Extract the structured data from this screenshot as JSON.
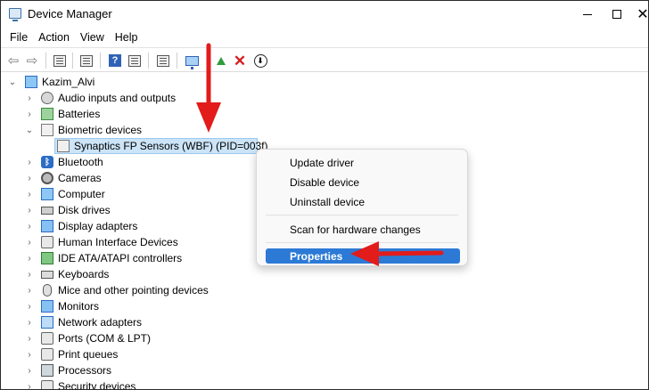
{
  "window": {
    "title": "Device Manager"
  },
  "menu": [
    "File",
    "Action",
    "View",
    "Help"
  ],
  "tree": {
    "root": "Kazim_Alvi",
    "categories": [
      {
        "label": "Audio inputs and outputs",
        "icon": "speaker-icon",
        "expanded": false
      },
      {
        "label": "Batteries",
        "icon": "battery-icon",
        "expanded": false
      },
      {
        "label": "Biometric devices",
        "icon": "fingerprint-icon",
        "expanded": true
      },
      {
        "label": "Bluetooth",
        "icon": "bluetooth-icon",
        "expanded": false
      },
      {
        "label": "Cameras",
        "icon": "camera-icon",
        "expanded": false
      },
      {
        "label": "Computer",
        "icon": "computer-icon",
        "expanded": false
      },
      {
        "label": "Disk drives",
        "icon": "disk-icon",
        "expanded": false
      },
      {
        "label": "Display adapters",
        "icon": "display-adapter-icon",
        "expanded": false
      },
      {
        "label": "Human Interface Devices",
        "icon": "hid-icon",
        "expanded": false
      },
      {
        "label": "IDE ATA/ATAPI controllers",
        "icon": "ide-icon",
        "expanded": false
      },
      {
        "label": "Keyboards",
        "icon": "keyboard-icon",
        "expanded": false
      },
      {
        "label": "Mice and other pointing devices",
        "icon": "mouse-icon",
        "expanded": false
      },
      {
        "label": "Monitors",
        "icon": "monitor-icon",
        "expanded": false
      },
      {
        "label": "Network adapters",
        "icon": "network-icon",
        "expanded": false
      },
      {
        "label": "Ports (COM & LPT)",
        "icon": "port-icon",
        "expanded": false
      },
      {
        "label": "Print queues",
        "icon": "printer-icon",
        "expanded": false
      },
      {
        "label": "Processors",
        "icon": "processor-icon",
        "expanded": false
      },
      {
        "label": "Security devices",
        "icon": "security-icon",
        "expanded": false
      }
    ],
    "selected_child": "Synaptics FP Sensors (WBF) (PID=003f)"
  },
  "context_menu": {
    "items": [
      "Update driver",
      "Disable device",
      "Uninstall device"
    ],
    "scan": "Scan for hardware changes",
    "properties": "Properties"
  },
  "colors": {
    "highlight": "#2c7ad6",
    "selection": "#cce4f7",
    "annotation": "#e21b1b"
  }
}
